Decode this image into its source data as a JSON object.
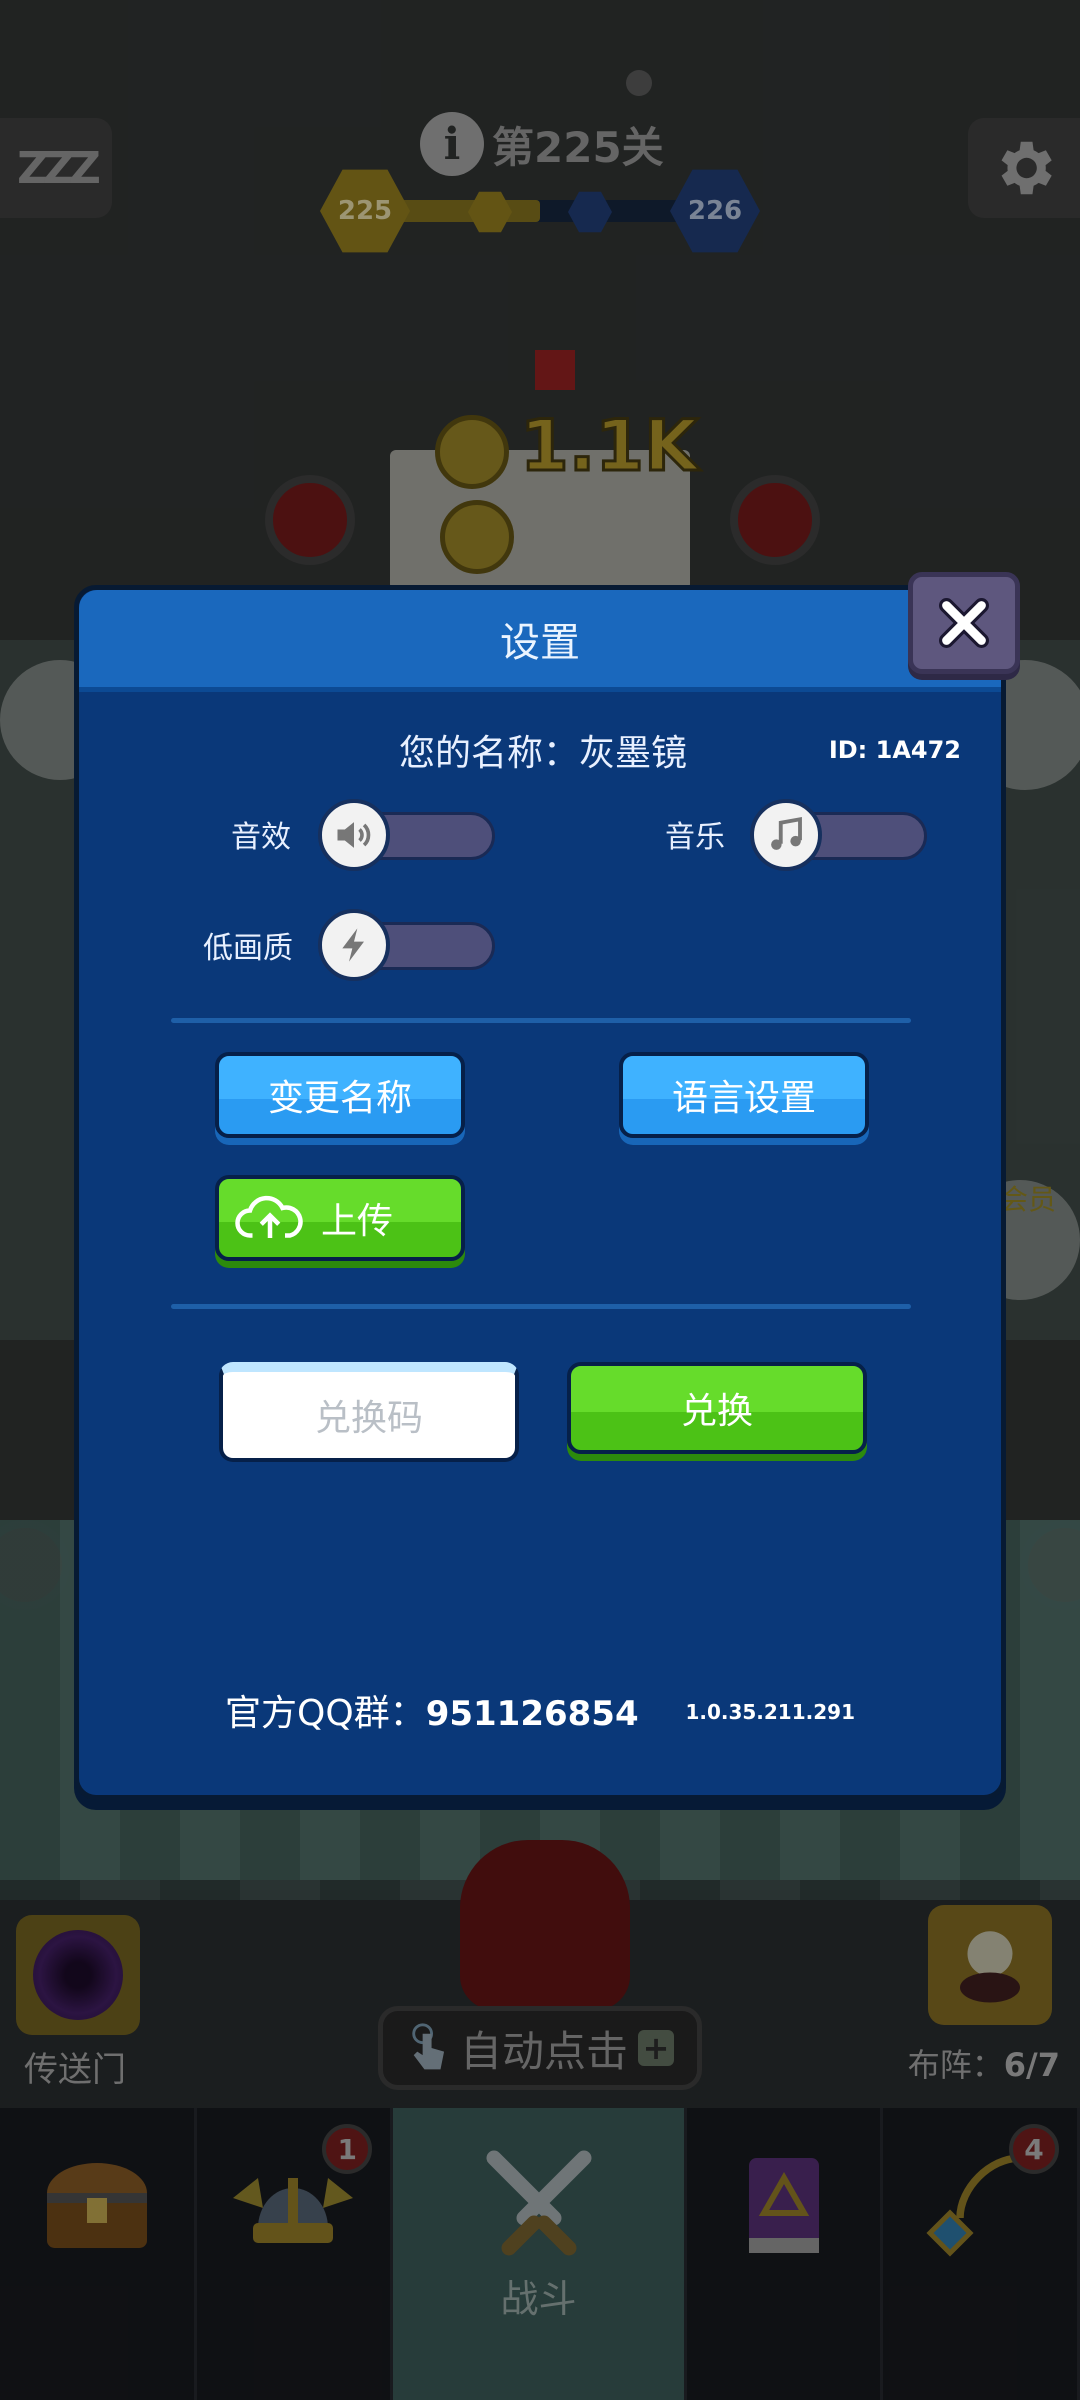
{
  "hud": {
    "level_text": "第225关",
    "level_current": "225",
    "level_next": "226",
    "info_icon": "i",
    "sleep_icon": "ZZZ",
    "stage_progress": 0.5
  },
  "background": {
    "coin_amount": "1.1K"
  },
  "settings": {
    "title": "设置",
    "name_line": "您的名称：灰墨镜",
    "id_line": "ID: 1A472",
    "sound_label": "音效",
    "music_label": "音乐",
    "low_quality_label": "低画质",
    "sound_on": false,
    "music_on": false,
    "low_quality_on": false,
    "change_name_label": "变更名称",
    "language_label": "语言设置",
    "upload_label": "上传",
    "redeem_placeholder": "兑换码",
    "redeem_button_label": "兑换",
    "qq_prefix": "官方QQ群：",
    "qq_number": "951126854",
    "version": "1.0.35.211.291"
  },
  "bottom": {
    "portal_label": "传送门",
    "autoclick_label": "自动点击",
    "formation_prefix": "布阵：",
    "formation_value": "6/7",
    "side_label_partial": "会员",
    "nav": [
      {
        "name": "chest",
        "label": "",
        "badge": ""
      },
      {
        "name": "helmet",
        "label": "",
        "badge": "1"
      },
      {
        "name": "battle",
        "label": "战斗",
        "badge": ""
      },
      {
        "name": "book",
        "label": "",
        "badge": ""
      },
      {
        "name": "amulet",
        "label": "",
        "badge": "4"
      }
    ]
  },
  "colors": {
    "dialog_bg": "#0a3879",
    "header_bg": "#1a68bd",
    "blue_button": "#3fb2ff",
    "green_button": "#5ad120"
  }
}
